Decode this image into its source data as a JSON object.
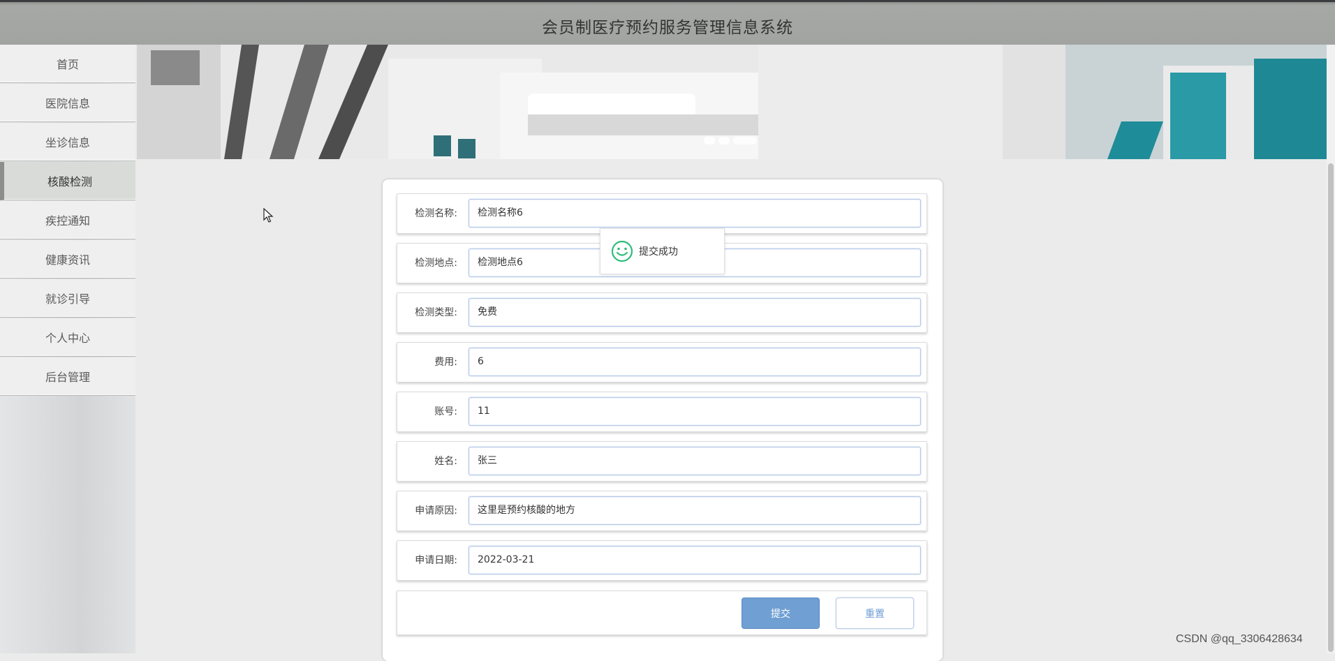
{
  "header": {
    "title": "会员制医疗预约服务管理信息系统"
  },
  "sidebar": {
    "items": [
      {
        "label": "首页"
      },
      {
        "label": "医院信息"
      },
      {
        "label": "坐诊信息"
      },
      {
        "label": "核酸检测",
        "active": true
      },
      {
        "label": "疾控通知"
      },
      {
        "label": "健康资讯"
      },
      {
        "label": "就诊引导"
      },
      {
        "label": "个人中心"
      },
      {
        "label": "后台管理"
      }
    ]
  },
  "banner": {
    "slide_count": 3
  },
  "form": {
    "fields": [
      {
        "label": "检测名称:",
        "value": "检测名称6"
      },
      {
        "label": "检测地点:",
        "value": "检测地点6"
      },
      {
        "label": "检测类型:",
        "value": "免费"
      },
      {
        "label": "费用:",
        "value": "6"
      },
      {
        "label": "账号:",
        "value": "11"
      },
      {
        "label": "姓名:",
        "value": "张三"
      },
      {
        "label": "申请原因:",
        "value": "这里是预约核酸的地方"
      },
      {
        "label": "申请日期:",
        "value": "2022-03-21"
      }
    ],
    "submit_label": "提交",
    "reset_label": "重置"
  },
  "toast": {
    "message": "提交成功",
    "icon": "smile-icon"
  },
  "watermark": "CSDN @qq_3306428634",
  "colors": {
    "accent": "#6f9fd3",
    "toast_icon": "#2ebd7a",
    "header_bg": "#a2a4a1"
  }
}
